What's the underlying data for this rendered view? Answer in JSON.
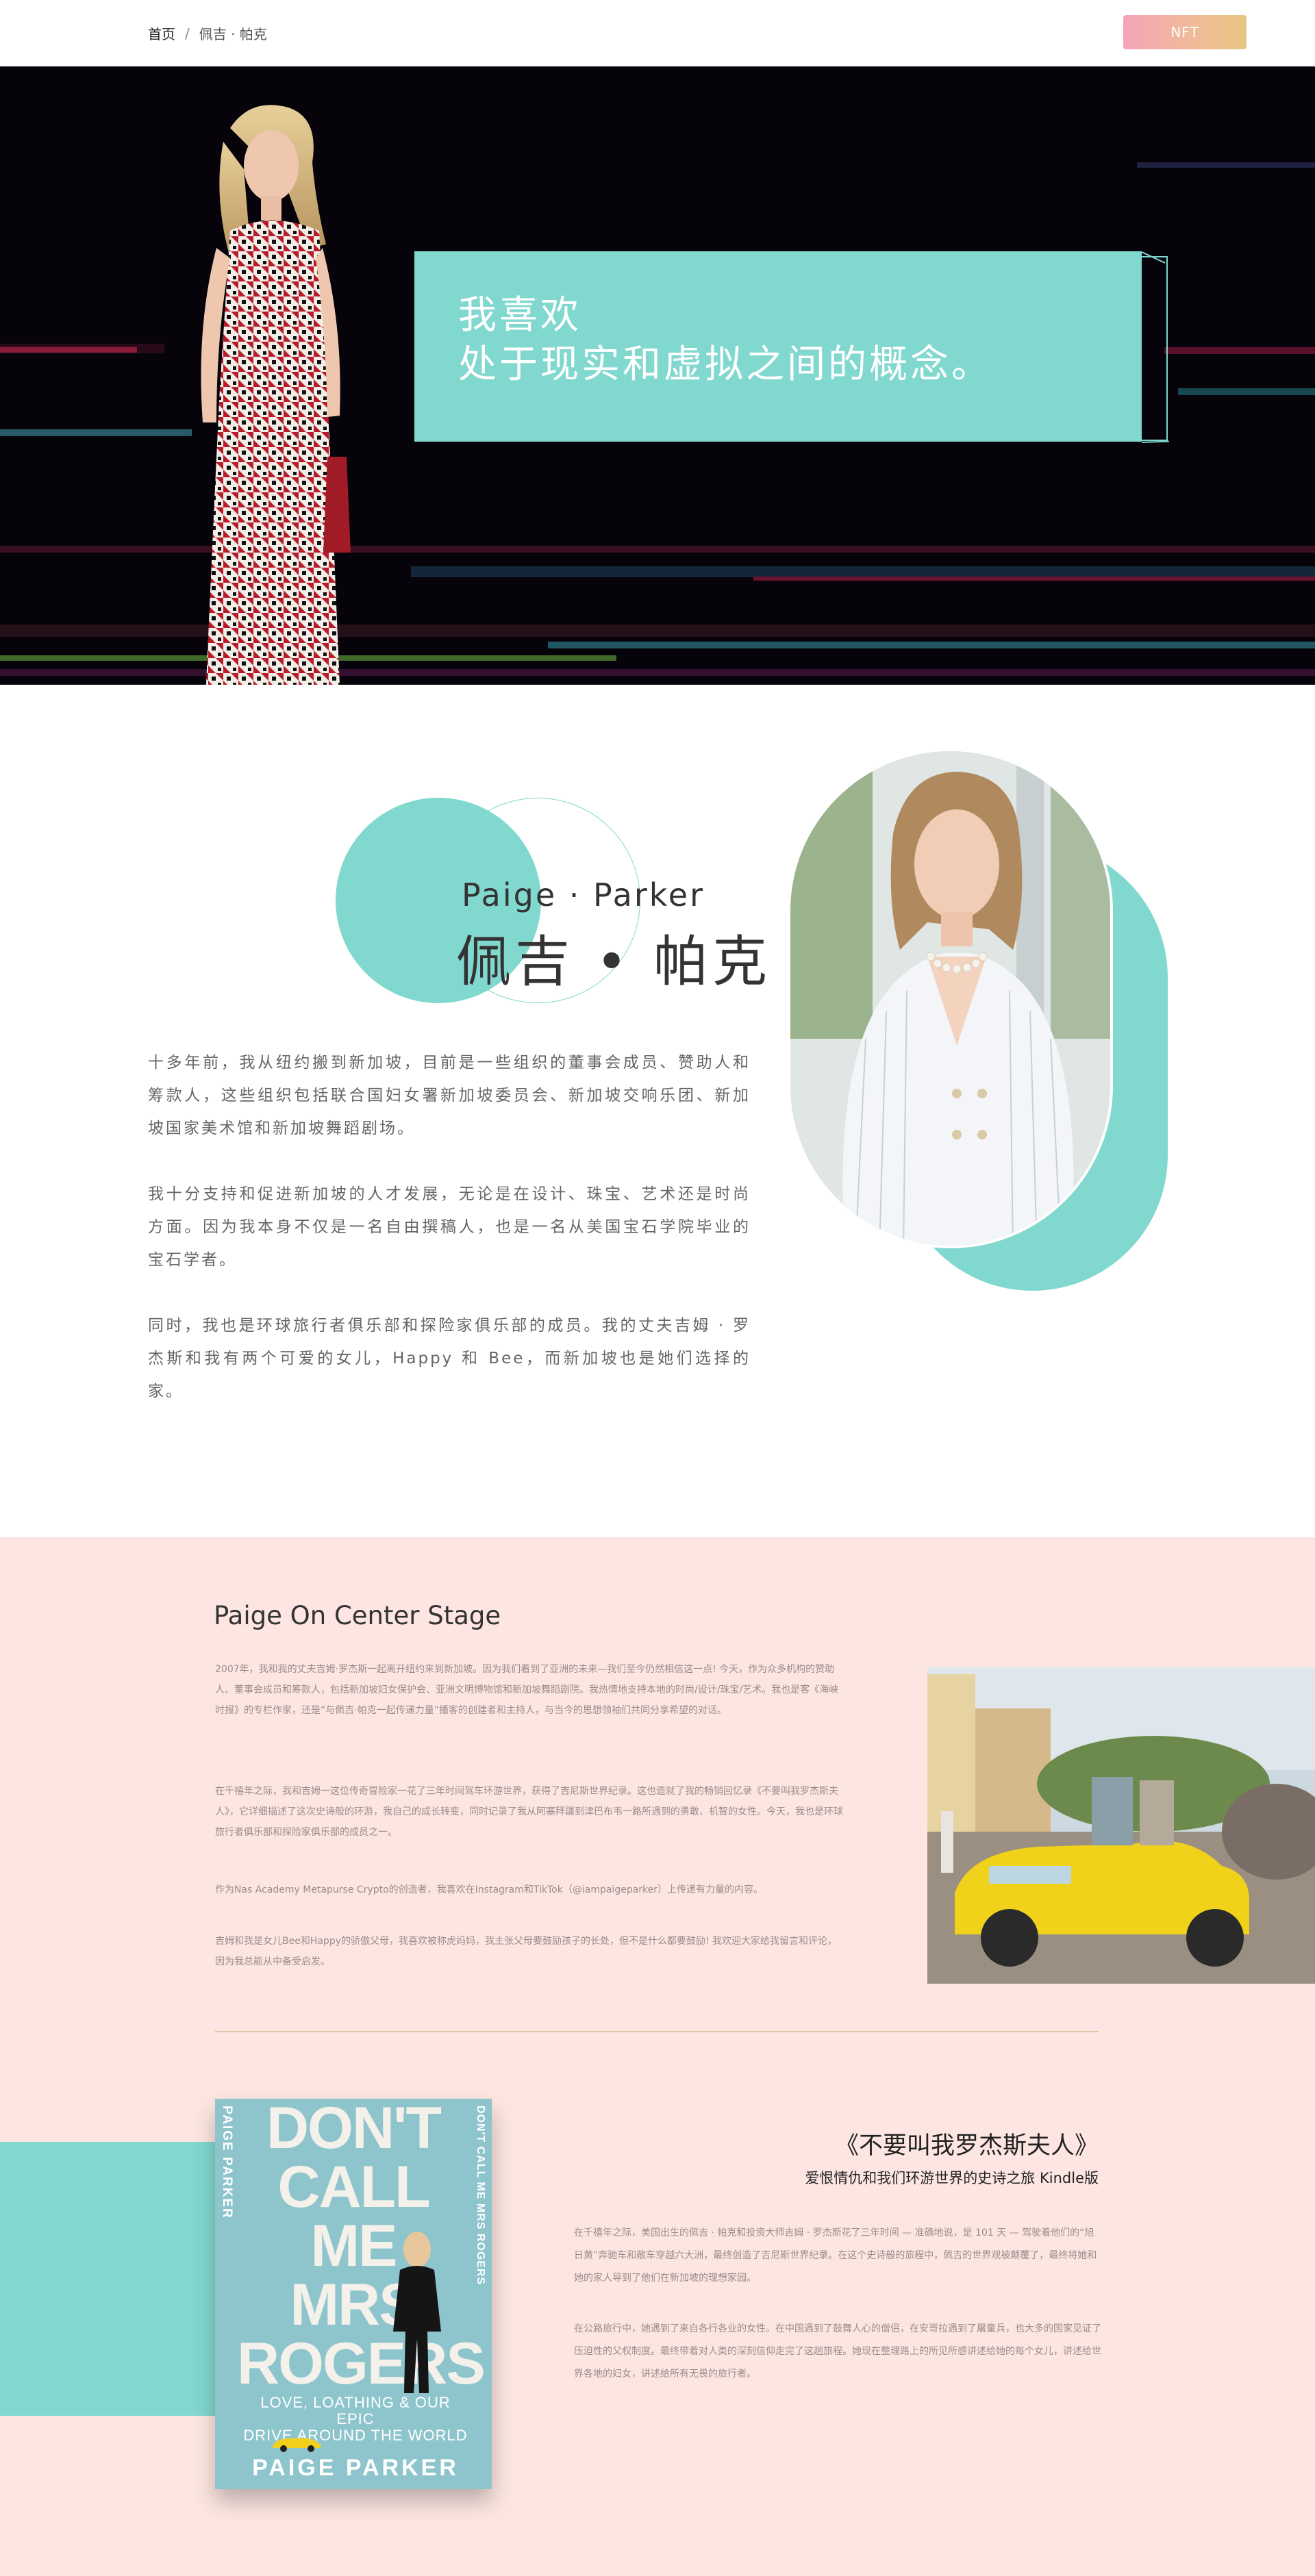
{
  "nav": {
    "breadcrumb_home": "首页",
    "breadcrumb_sep": "/",
    "breadcrumb_current": "佩吉 · 帕克",
    "nft_button": "NFT"
  },
  "hero": {
    "quote_line1": "我喜欢",
    "quote_line2": "处于现实和虚拟之间的概念。"
  },
  "bio": {
    "name_en": "Paige · Parker",
    "name_cn": "佩吉 • 帕克",
    "paragraphs": [
      "十多年前，我从纽约搬到新加坡，目前是一些组织的董事会成员、赞助人和筹款人，这些组织包括联合国妇女署新加坡委员会、新加坡交响乐团、新加坡国家美术馆和新加坡舞蹈剧场。",
      "我十分支持和促进新加坡的人才发展，无论是在设计、珠宝、艺术还是时尚方面。因为我本身不仅是一名自由撰稿人，也是一名从美国宝石学院毕业的宝石学者。",
      "同时，我也是环球旅行者俱乐部和探险家俱乐部的成员。我的丈夫吉姆 · 罗杰斯和我有两个可爱的女儿，Happy 和 Bee，而新加坡也是她们选择的家。"
    ]
  },
  "stage": {
    "title": "Paige On Center Stage",
    "paragraphs": [
      "2007年，我和我的丈夫吉姆·罗杰斯一起离开纽约来到新加坡。因为我们看到了亚洲的未来—我们至今仍然相信这一点! 今天，作为众多机构的赞助人、董事会成员和筹款人，包括新加坡妇女保护会、亚洲文明博物馆和新加坡舞蹈剧院。我热情地支持本地的时尚/设计/珠宝/艺术。我也是客《海峡时报》的专栏作家，还是“与佩吉·帕克一起传递力量”播客的创建者和主持人，与当今的思想领袖们共同分享希望的对话。",
      "在千禧年之际，我和吉姆一这位传奇冒险家一花了三年时间驾车环游世界，获得了吉尼斯世界纪录。这也造就了我的畅销回忆录《不要叫我罗杰斯夫人》，它详细描述了这次史诗般的环游，我自己的成长转变，同时记录了我从阿塞拜疆到津巴布韦一路所遇到的勇敢、机智的女性。今天，我也是环球旅行者俱乐部和探险家俱乐部的成员之一。",
      "作为Nas Academy Metapurse Crypto的创造者，我喜欢在Instagram和TikTok（@iampaigeparker）上传递有力量的内容。",
      "吉姆和我是女儿Bee和Happy的骄傲父母，我喜欢被称虎妈妈，我主张父母要鼓励孩子的长处，但不是什么都要鼓励! 我欢迎大家给我留言和评论，因为我总能从中备受启发。"
    ]
  },
  "book": {
    "title": "《不要叫我罗杰斯夫人》",
    "subtitle": "爱恨情仇和我们环游世界的史诗之旅  Kindle版",
    "cover_big": [
      "DON'T",
      "CALL ME",
      "MRS",
      "ROGERS"
    ],
    "cover_spine_left": "PAIGE PARKER",
    "cover_spine_right": "DON'T CALL ME MRS ROGERS",
    "cover_tagline": [
      "LOVE, LOATHING & OUR EPIC",
      "DRIVE AROUND THE WORLD"
    ],
    "cover_author": "PAIGE PARKER",
    "paragraphs": [
      "在千禧年之际，美国出生的佩吉 · 帕克和投资大师吉姆 · 罗杰斯花了三年时间 — 准确地说，是 101 天 — 驾驶着他们的“旭日黄”奔驰车和敞车穿越六大洲，最终创造了吉尼斯世界纪录。在这个史诗般的旅程中，佩吉的世界观被颠覆了，最终将她和她的家人导到了他们在新加坡的理想家园。",
      "在公路旅行中，她遇到了来自各行各业的女性。在中国遇到了鼓舞人心的僧侣，在安哥拉遇到了屠童兵，也大多的国家见证了压迫性的父权制度。最终带着对人类的深刻信仰走完了这趟旅程。她现在整理路上的所见所感讲述给她的每个女儿，讲述给世界各地的妇女，讲述给所有无畏的旅行者。"
    ]
  },
  "colors": {
    "mint": "#81d8cf",
    "pink_bg": "#fde6e2",
    "hero_bg": "#06030a",
    "nft_gradient": [
      "#f5a4b9",
      "#e8c584"
    ]
  }
}
